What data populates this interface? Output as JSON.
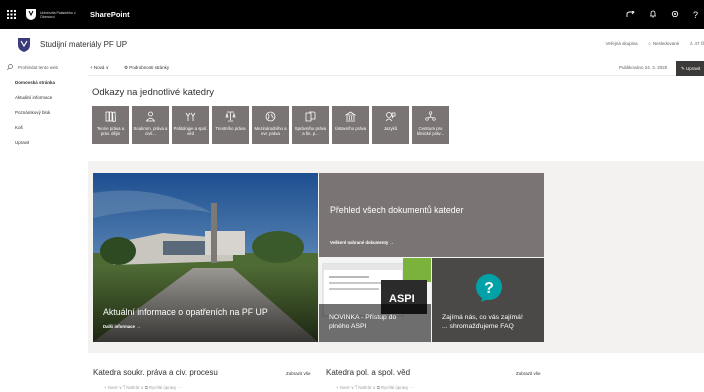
{
  "topbar": {
    "university_text": "Univerzita Palackého v Olomouci",
    "brand": "SharePoint",
    "icons": [
      "waffle-icon",
      "share-icon",
      "bell-icon",
      "gear-icon",
      "help-icon"
    ],
    "help_glyph": "?"
  },
  "site": {
    "title": "Studijní materiály PF UP",
    "group_type": "Veřejná skupina",
    "follow": "Nesledované",
    "members": "47 čl"
  },
  "nav": {
    "search_placeholder": "Prohledat tento web",
    "items": [
      "Domovská stránka",
      "Aktuální informace",
      "Poznámkový blok",
      "Koš",
      "Upravit"
    ]
  },
  "command_bar": {
    "new_label": "Nová",
    "details_label": "Podrobnosti stránky",
    "published": "Publikováno 24. 3. 2020",
    "edit_label": "Upravit"
  },
  "links": {
    "title": "Odkazy na jednotlivé katedry",
    "tiles": [
      {
        "label": "Teorie práva a práv. dějin",
        "icon": "books-icon"
      },
      {
        "label": "Soukrom. práva a civil...",
        "icon": "person-icon"
      },
      {
        "label": "Politologie a spol. věd",
        "icon": "people-icon"
      },
      {
        "label": "Trestního práva",
        "icon": "gavel-icon"
      },
      {
        "label": "Mezinárodního a evr. práva",
        "icon": "globe-icon"
      },
      {
        "label": "Správního práva a fin. p...",
        "icon": "documents-icon"
      },
      {
        "label": "Ústavního práva",
        "icon": "building-icon"
      },
      {
        "label": "Jazyků",
        "icon": "speech-icon"
      },
      {
        "label": "Centrum pro klinické práv...",
        "icon": "network-icon"
      }
    ]
  },
  "hero": {
    "main_caption": "Aktuální informace o opatřeních na PF UP",
    "main_link": "Další informace →",
    "doc_title": "Přehled všech dokumentů kateder",
    "doc_link": "Veškeré nahrané dokumenty →",
    "aspi_line1": "NOVINKA - Přístup do",
    "aspi_line2": "plného ASPI",
    "aspi_logo": "ASPI",
    "faq_line1": "Zajímá nás, co vás zajímá!",
    "faq_line2": "... shromažďujeme FAQ",
    "faq_glyph": "?"
  },
  "sections": [
    {
      "title": "Katedra soukr. práva a civ. procesu",
      "see_all": "Zobrazit vše",
      "cmd": "+ Nové ∨   ⤒ Nahrát ∨   ⧉ Rychlé úpravy   ···"
    },
    {
      "title": "Katedra pol. a spol. věd",
      "see_all": "Zobrazit vše",
      "cmd": "+ Nové ∨   ⤒ Nahrát ∨   ⧉ Rychlé úpravy   ···"
    }
  ],
  "colors": {
    "topbar": "#000000",
    "tile": "#7a7574",
    "band": "#f3f2f1",
    "faq_accent": "#00a2a8"
  }
}
